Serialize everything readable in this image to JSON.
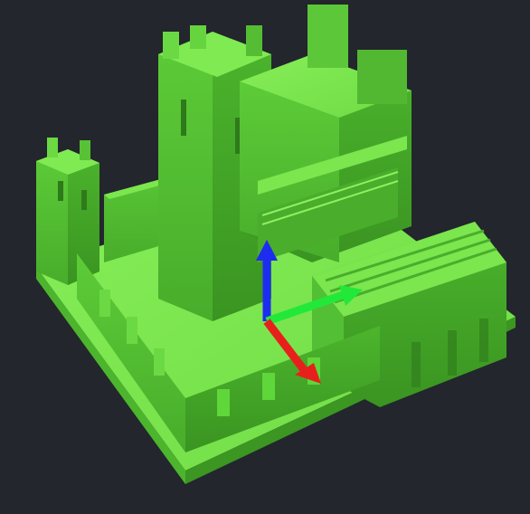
{
  "viewport": {
    "background": "#23262c"
  },
  "model": {
    "subject": "voxel-castle",
    "color": "#5fd63a",
    "top_color": "#7be64e",
    "left_color": "#4fb52f",
    "right_color": "#3f9a25",
    "edge_color": "#2e7a1a"
  },
  "gizmo": {
    "axes": [
      {
        "name": "x",
        "color": "#e8201c"
      },
      {
        "name": "y",
        "color": "#22e83a"
      },
      {
        "name": "z",
        "color": "#1d2df0"
      }
    ]
  }
}
